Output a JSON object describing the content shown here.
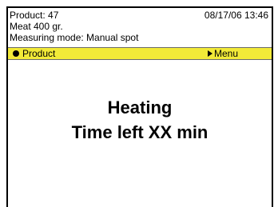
{
  "header": {
    "product_line": "Product: 47",
    "item_line": "Meat 400 gr.",
    "mode_line": "Measuring mode: Manual spot",
    "datetime": "08/17/06 13:46"
  },
  "softkeys": {
    "left_label": "Product",
    "left_icon": "filled-circle-icon",
    "right_label": "Menu",
    "right_icon": "triangle-right-icon",
    "bar_color": "#f2ea38"
  },
  "main": {
    "status_line": "Heating",
    "time_line": "Time left XX min"
  }
}
